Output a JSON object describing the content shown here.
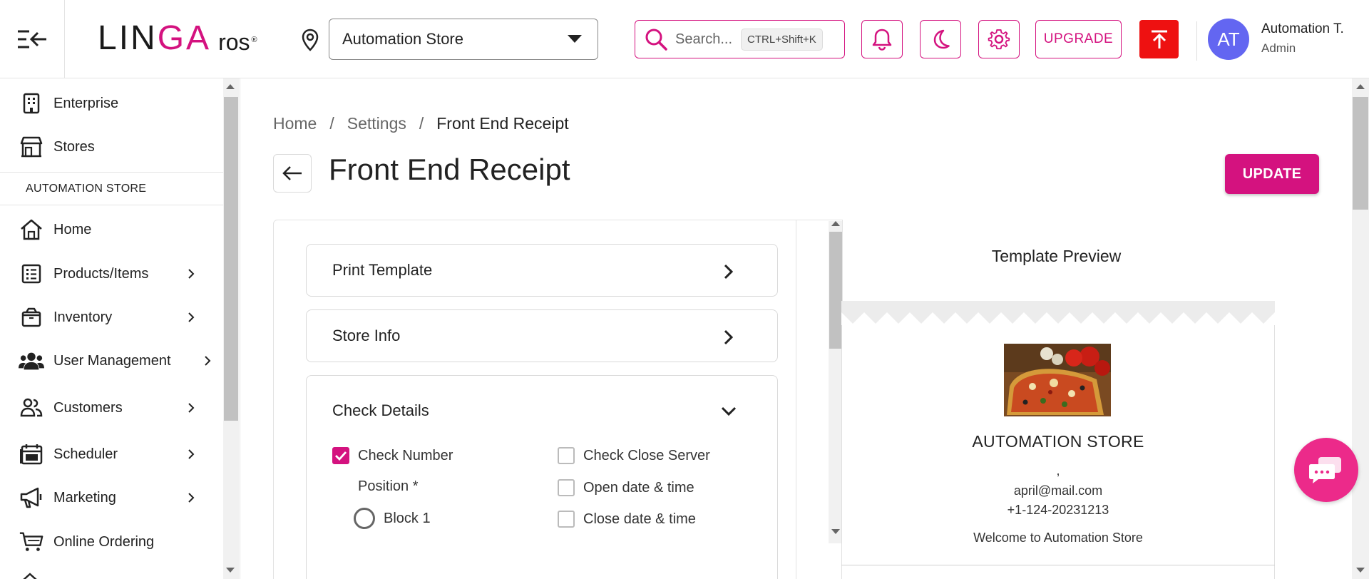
{
  "header": {
    "logo": {
      "part1": "LIN",
      "part2": "GA",
      "part3": "ros",
      "mark": "®"
    },
    "store_select": {
      "value": "Automation Store"
    },
    "search": {
      "placeholder": "Search...",
      "shortcut": "CTRL+Shift+K"
    },
    "upgrade_label": "UPGRADE",
    "user": {
      "initials": "AT",
      "name": "Automation T.",
      "role": "Admin"
    },
    "accent_color": "#d4127f",
    "icons": [
      "menu-collapse-icon",
      "location-pin-icon",
      "search-icon",
      "bell-icon",
      "moon-icon",
      "gear-icon",
      "upload-arrow-icon"
    ]
  },
  "sidebar": {
    "top_items": [
      {
        "label": "Enterprise",
        "icon": "building-icon"
      },
      {
        "label": "Stores",
        "icon": "store-icon"
      }
    ],
    "section_label": "AUTOMATION STORE",
    "items": [
      {
        "label": "Home",
        "icon": "home-icon"
      },
      {
        "label": "Products/Items",
        "icon": "list-icon"
      },
      {
        "label": "Inventory",
        "icon": "box-icon"
      },
      {
        "label": "User Management",
        "icon": "users-icon"
      },
      {
        "label": "Customers",
        "icon": "customers-icon"
      },
      {
        "label": "Scheduler",
        "icon": "calendar-icon"
      },
      {
        "label": "Marketing",
        "icon": "megaphone-icon"
      },
      {
        "label": "Online Ordering",
        "icon": "cart-icon"
      }
    ]
  },
  "breadcrumb": {
    "items": [
      "Home",
      "Settings",
      "Front End Receipt"
    ],
    "separator": "/"
  },
  "page": {
    "title": "Front End Receipt",
    "update_label": "UPDATE"
  },
  "settings": {
    "print_template": "Print Template",
    "store_info": "Store Info",
    "check_details": {
      "title": "Check Details",
      "check_number": {
        "label": "Check Number",
        "checked": true
      },
      "position_label": "Position *",
      "block1_label": "Block 1",
      "check_close_server": {
        "label": "Check Close Server",
        "checked": false
      },
      "open_datetime": {
        "label": "Open date & time",
        "checked": false
      },
      "close_datetime": {
        "label": "Close date & time",
        "checked": false
      }
    }
  },
  "preview": {
    "title": "Template Preview",
    "store_name": "AUTOMATION STORE",
    "comma": ",",
    "email": "april@mail.com",
    "phone": "+1-124-20231213",
    "welcome": "Welcome to Automation Store"
  }
}
